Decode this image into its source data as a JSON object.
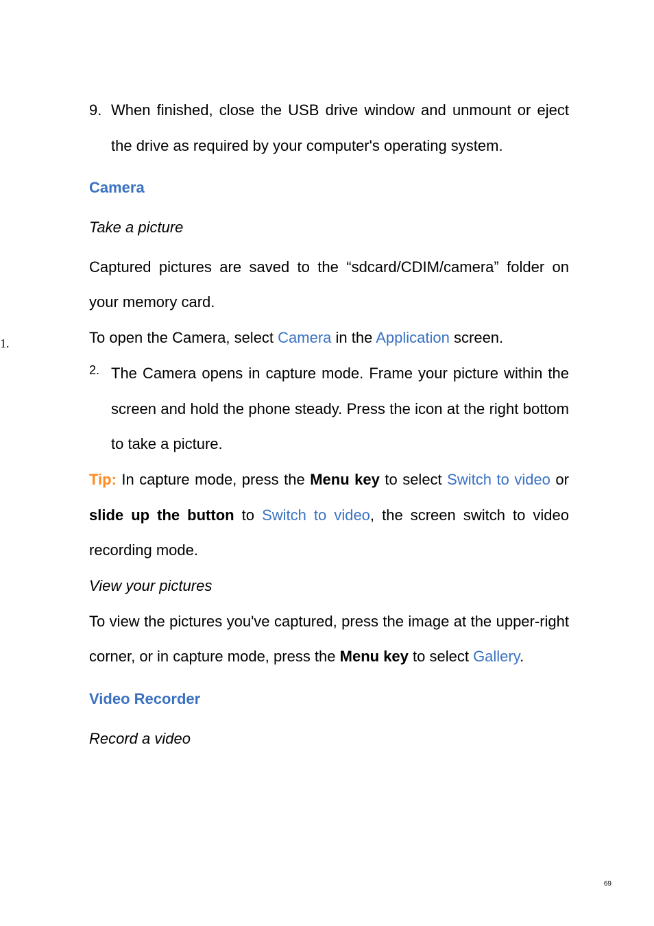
{
  "side_marker": "1.",
  "step9_num": "9.",
  "step9_text": "When finished, close the USB drive window and unmount or eject the drive as required by your computer's operating system.",
  "camera_heading": "Camera",
  "take_picture_heading": "Take a picture",
  "captured_text": "Captured pictures are saved to the “sdcard/CDIM/camera” folder on your memory card.",
  "step1_pre": "To open the Camera, select ",
  "step1_camera": "Camera",
  "step1_mid": " in the ",
  "step1_app": "Application",
  "step1_post": " screen.",
  "step2_num": "2.",
  "step2_text": "The Camera opens in capture mode. Frame your picture within the screen and hold the phone steady. Press the icon at the right bottom to take a picture.",
  "tip_label": "Tip:",
  "tip_1": " In capture mode, press the ",
  "tip_menu": "Menu key",
  "tip_2": " to select ",
  "tip_switch1": "Switch to video",
  "tip_3": " or ",
  "tip_slide": "slide up the button",
  "tip_4": " to ",
  "tip_switch2": "Switch to video",
  "tip_5": ", the screen switch to video recording mode.",
  "view_heading": "View your pictures",
  "view_1": "To view the pictures you've captured, press the image at the upper-right corner, or in capture mode, press the ",
  "view_menu": "Menu key",
  "view_2": " to select ",
  "view_gallery": "Gallery",
  "view_3": ".",
  "video_heading": "Video Recorder",
  "record_heading": "Record a video",
  "page_number": "69"
}
